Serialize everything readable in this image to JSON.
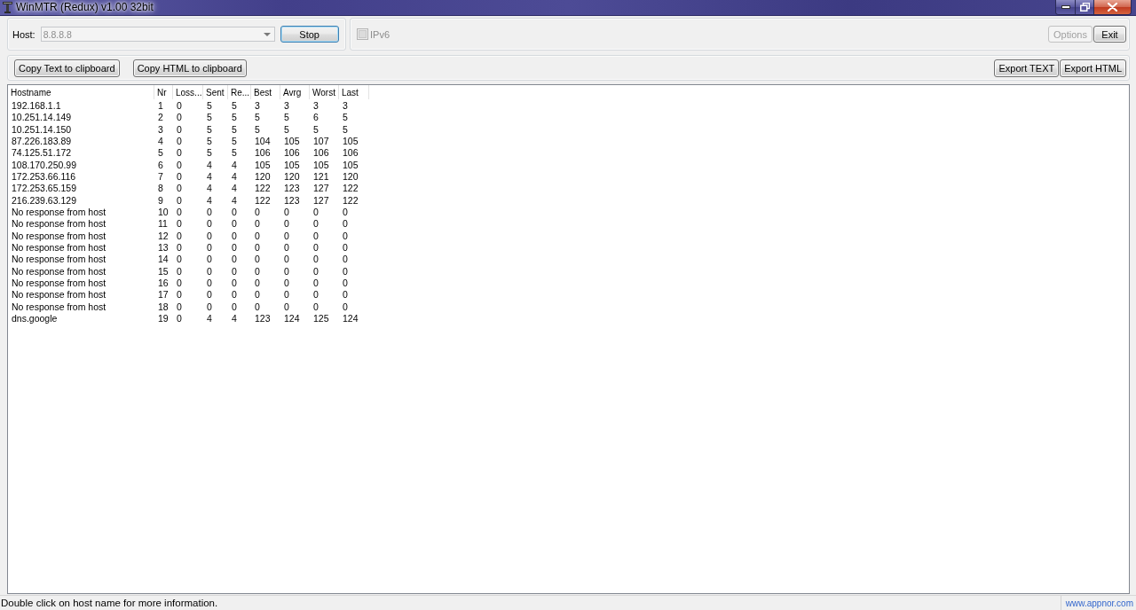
{
  "window": {
    "title": "WinMTR (Redux) v1.00 32bit"
  },
  "host": {
    "label": "Host:",
    "value": "8.8.8.8",
    "disabled": true
  },
  "stop_button": {
    "label": "Stop",
    "default": true
  },
  "ipv6": {
    "label": "IPv6",
    "checked": false,
    "disabled": true
  },
  "top_buttons": [
    {
      "label": "Options",
      "disabled": true
    },
    {
      "label": "Exit",
      "disabled": false
    }
  ],
  "copy_buttons": [
    "Copy Text to clipboard",
    "Copy HTML to clipboard"
  ],
  "export_buttons": [
    "Export TEXT",
    "Export HTML"
  ],
  "table": {
    "columns": [
      "Hostname",
      "Nr",
      "Loss...",
      "Sent",
      "Re...",
      "Best",
      "Avrg",
      "Worst",
      "Last"
    ],
    "rows": [
      [
        "192.168.1.1",
        "1",
        "0",
        "5",
        "5",
        "3",
        "3",
        "3",
        "3"
      ],
      [
        "10.251.14.149",
        "2",
        "0",
        "5",
        "5",
        "5",
        "5",
        "6",
        "5"
      ],
      [
        "10.251.14.150",
        "3",
        "0",
        "5",
        "5",
        "5",
        "5",
        "5",
        "5"
      ],
      [
        "87.226.183.89",
        "4",
        "0",
        "5",
        "5",
        "104",
        "105",
        "107",
        "105"
      ],
      [
        "74.125.51.172",
        "5",
        "0",
        "5",
        "5",
        "106",
        "106",
        "106",
        "106"
      ],
      [
        "108.170.250.99",
        "6",
        "0",
        "4",
        "4",
        "105",
        "105",
        "105",
        "105"
      ],
      [
        "172.253.66.116",
        "7",
        "0",
        "4",
        "4",
        "120",
        "120",
        "121",
        "120"
      ],
      [
        "172.253.65.159",
        "8",
        "0",
        "4",
        "4",
        "122",
        "123",
        "127",
        "122"
      ],
      [
        "216.239.63.129",
        "9",
        "0",
        "4",
        "4",
        "122",
        "123",
        "127",
        "122"
      ],
      [
        "No response from host",
        "10",
        "0",
        "0",
        "0",
        "0",
        "0",
        "0",
        "0"
      ],
      [
        "No response from host",
        "11",
        "0",
        "0",
        "0",
        "0",
        "0",
        "0",
        "0"
      ],
      [
        "No response from host",
        "12",
        "0",
        "0",
        "0",
        "0",
        "0",
        "0",
        "0"
      ],
      [
        "No response from host",
        "13",
        "0",
        "0",
        "0",
        "0",
        "0",
        "0",
        "0"
      ],
      [
        "No response from host",
        "14",
        "0",
        "0",
        "0",
        "0",
        "0",
        "0",
        "0"
      ],
      [
        "No response from host",
        "15",
        "0",
        "0",
        "0",
        "0",
        "0",
        "0",
        "0"
      ],
      [
        "No response from host",
        "16",
        "0",
        "0",
        "0",
        "0",
        "0",
        "0",
        "0"
      ],
      [
        "No response from host",
        "17",
        "0",
        "0",
        "0",
        "0",
        "0",
        "0",
        "0"
      ],
      [
        "No response from host",
        "18",
        "0",
        "0",
        "0",
        "0",
        "0",
        "0",
        "0"
      ],
      [
        "dns.google",
        "19",
        "0",
        "4",
        "4",
        "123",
        "124",
        "125",
        "124"
      ]
    ]
  },
  "status_bar": {
    "message": "Double click on host name for more information.",
    "link": "www.appnor.com"
  }
}
